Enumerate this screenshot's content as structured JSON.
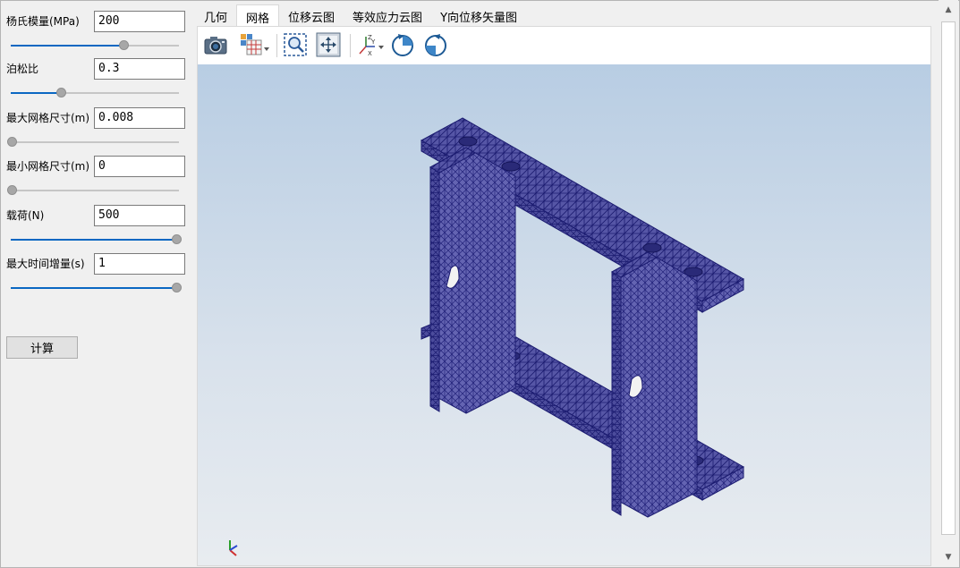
{
  "params": [
    {
      "label": "杨氏模量(MPa)",
      "value": "200",
      "slider": 0.68
    },
    {
      "label": "泊松比",
      "value": "0.3",
      "slider": 0.3
    },
    {
      "label": "最大网格尺寸(m)",
      "value": "0.008",
      "slider": 0.0
    },
    {
      "label": "最小网格尺寸(m)",
      "value": "0",
      "slider": 0.0
    },
    {
      "label": "载荷(N)",
      "value": "500",
      "slider": 1.0
    },
    {
      "label": "最大时间增量(s)",
      "value": "1",
      "slider": 1.0
    }
  ],
  "calc_button": "计算",
  "tabs": [
    "几何",
    "网格",
    "位移云图",
    "等效应力云图",
    "Y向位移矢量图"
  ],
  "active_tab": 1,
  "toolbar": [
    "camera-icon",
    "view-cube-icon",
    "zoom-box-icon",
    "fit-view-icon",
    "axes-icon",
    "rotate-cw-icon",
    "rotate-ccw-icon"
  ],
  "colors": {
    "mesh_face": "#5a5aa8",
    "mesh_line": "#1a1a6e",
    "accent": "#0a67c2"
  }
}
